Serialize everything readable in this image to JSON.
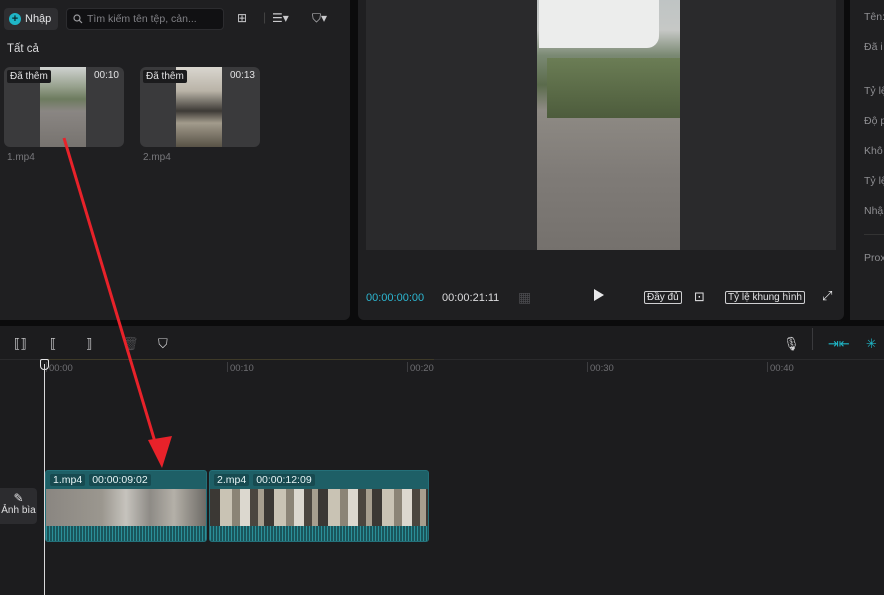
{
  "media": {
    "import_label": "Nhập",
    "search_placeholder": "Tìm kiếm tên tệp, cản...",
    "section_title": "Tất cả",
    "items": [
      {
        "badge": "Đã thêm",
        "duration": "00:10",
        "name": "1.mp4"
      },
      {
        "badge": "Đã thêm",
        "duration": "00:13",
        "name": "2.mp4"
      }
    ]
  },
  "player": {
    "current_time": "00:00:00:00",
    "total_time": "00:00:21:11",
    "full_label": "Đầy đủ",
    "ratio_label": "Tỷ lệ khung hình"
  },
  "properties": {
    "labels": [
      "Tên:",
      "Đã i",
      "Tỷ lệ",
      "Độ p",
      "Khô",
      "Tỷ lệ",
      "Nhậ",
      "Prox"
    ]
  },
  "timeline": {
    "ticks": [
      "00:00",
      "00:10",
      "00:20",
      "00:30",
      "00:40"
    ],
    "clips": [
      {
        "name": "1.mp4",
        "duration": "00:00:09:02"
      },
      {
        "name": "2.mp4",
        "duration": "00:00:12:09"
      }
    ],
    "cover_label": "Ảnh bìa"
  },
  "colors": {
    "accent": "#1fb6c7",
    "clip": "#1e5f66",
    "annotation_arrow": "#e8222a"
  }
}
